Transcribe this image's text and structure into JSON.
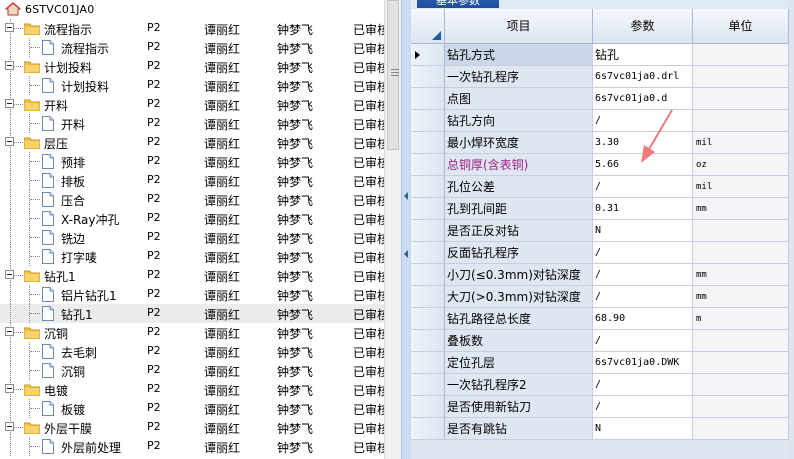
{
  "tree": {
    "root_label": "6STVC01JA0",
    "rows": [
      {
        "level": 1,
        "name": "流程指示",
        "code": "P2",
        "maker": "谭丽红",
        "checker": "钟梦飞",
        "status": "已审核"
      },
      {
        "level": 2,
        "name": "流程指示",
        "code": "P2",
        "maker": "谭丽红",
        "checker": "钟梦飞",
        "status": "已审核"
      },
      {
        "level": 1,
        "name": "计划投料",
        "code": "P2",
        "maker": "谭丽红",
        "checker": "钟梦飞",
        "status": "已审核"
      },
      {
        "level": 2,
        "name": "计划投料",
        "code": "P2",
        "maker": "谭丽红",
        "checker": "钟梦飞",
        "status": "已审核"
      },
      {
        "level": 1,
        "name": "开料",
        "code": "P2",
        "maker": "谭丽红",
        "checker": "钟梦飞",
        "status": "已审核"
      },
      {
        "level": 2,
        "name": "开料",
        "code": "P2",
        "maker": "谭丽红",
        "checker": "钟梦飞",
        "status": "已审核"
      },
      {
        "level": 1,
        "name": "层压",
        "code": "P2",
        "maker": "谭丽红",
        "checker": "钟梦飞",
        "status": "已审核"
      },
      {
        "level": 2,
        "name": "预排",
        "code": "P2",
        "maker": "谭丽红",
        "checker": "钟梦飞",
        "status": "已审核"
      },
      {
        "level": 2,
        "name": "排板",
        "code": "P2",
        "maker": "谭丽红",
        "checker": "钟梦飞",
        "status": "已审核"
      },
      {
        "level": 2,
        "name": "压合",
        "code": "P2",
        "maker": "谭丽红",
        "checker": "钟梦飞",
        "status": "已审核"
      },
      {
        "level": 2,
        "name": "X-Ray冲孔",
        "code": "P2",
        "maker": "谭丽红",
        "checker": "钟梦飞",
        "status": "已审核"
      },
      {
        "level": 2,
        "name": "铣边",
        "code": "P2",
        "maker": "谭丽红",
        "checker": "钟梦飞",
        "status": "已审核"
      },
      {
        "level": 2,
        "name": "打字唛",
        "code": "P2",
        "maker": "谭丽红",
        "checker": "钟梦飞",
        "status": "已审核"
      },
      {
        "level": 1,
        "name": "钻孔1",
        "code": "P2",
        "maker": "谭丽红",
        "checker": "钟梦飞",
        "status": "已审核"
      },
      {
        "level": 2,
        "name": "铝片钻孔1",
        "code": "P2",
        "maker": "谭丽红",
        "checker": "钟梦飞",
        "status": "已审核"
      },
      {
        "level": 2,
        "name": "钻孔1",
        "code": "P2",
        "maker": "谭丽红",
        "checker": "钟梦飞",
        "status": "已审核",
        "selected": true
      },
      {
        "level": 1,
        "name": "沉铜",
        "code": "P2",
        "maker": "谭丽红",
        "checker": "钟梦飞",
        "status": "已审核"
      },
      {
        "level": 2,
        "name": "去毛刺",
        "code": "P2",
        "maker": "谭丽红",
        "checker": "钟梦飞",
        "status": "已审核"
      },
      {
        "level": 2,
        "name": "沉铜",
        "code": "P2",
        "maker": "谭丽红",
        "checker": "钟梦飞",
        "status": "已审核"
      },
      {
        "level": 1,
        "name": "电镀",
        "code": "P2",
        "maker": "谭丽红",
        "checker": "钟梦飞",
        "status": "已审核"
      },
      {
        "level": 2,
        "name": "板镀",
        "code": "P2",
        "maker": "谭丽红",
        "checker": "钟梦飞",
        "status": "已审核"
      },
      {
        "level": 1,
        "name": "外层干膜",
        "code": "P2",
        "maker": "谭丽红",
        "checker": "钟梦飞",
        "status": "已审核"
      },
      {
        "level": 2,
        "name": "外层前处理",
        "code": "P2",
        "maker": "谭丽红",
        "checker": "钟梦飞",
        "status": "已审核"
      }
    ]
  },
  "tab_label": "基本参数",
  "grid": {
    "headers": {
      "item": "项目",
      "param": "参数",
      "unit": "单位"
    },
    "rows": [
      {
        "name": "钻孔方式",
        "value": "钻孔",
        "unit": "",
        "current": true
      },
      {
        "name": "一次钻孔程序",
        "value": "6s7vc01ja0.drl",
        "unit": ""
      },
      {
        "name": "点图",
        "value": "6s7vc01ja0.d",
        "unit": ""
      },
      {
        "name": "钻孔方向",
        "value": "/",
        "unit": ""
      },
      {
        "name": "最小焊环宽度",
        "value": "3.30",
        "unit": "mil"
      },
      {
        "name": "总铜厚(含表铜)",
        "value": "5.66",
        "unit": "oz",
        "highlight": true
      },
      {
        "name": "孔位公差",
        "value": "/",
        "unit": "mil"
      },
      {
        "name": "孔到孔间距",
        "value": "0.31",
        "unit": "mm"
      },
      {
        "name": "是否正反对钻",
        "value": "N",
        "unit": ""
      },
      {
        "name": "反面钻孔程序",
        "value": "/",
        "unit": ""
      },
      {
        "name": "小刀(≤0.3mm)对钻深度",
        "value": "/",
        "unit": "mm"
      },
      {
        "name": "大刀(>0.3mm)对钻深度",
        "value": "/",
        "unit": "mm"
      },
      {
        "name": "钻孔路径总长度",
        "value": "68.90",
        "unit": "m"
      },
      {
        "name": "叠板数",
        "value": "/",
        "unit": ""
      },
      {
        "name": "定位孔层",
        "value": "6s7vc01ja0.DWK",
        "unit": ""
      },
      {
        "name": "一次钻孔程序2",
        "value": "/",
        "unit": ""
      },
      {
        "name": "是否使用新钻刀",
        "value": "/",
        "unit": ""
      },
      {
        "name": "是否有跳钻",
        "value": "N",
        "unit": ""
      }
    ]
  },
  "colors": {
    "accent": "#1f5ca8",
    "highlight_text": "#9b2185",
    "arrow": "#f07a7a",
    "folder": "#f2c244"
  }
}
